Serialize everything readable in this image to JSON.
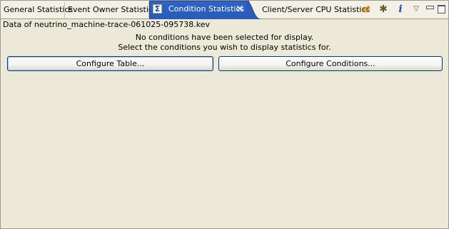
{
  "tabs": [
    {
      "label": "General Statistics",
      "active": false
    },
    {
      "label": "Event Owner Statistics",
      "active": false
    },
    {
      "label": "Condition Statistics",
      "active": true,
      "icon": "sigma-icon"
    },
    {
      "label": "Client/Server CPU Statistics",
      "active": false
    }
  ],
  "active_tab_close": "✕",
  "toolbar": {
    "sync_icon": "⇄",
    "bug_icon": "✱",
    "info_icon": "i",
    "menu_icon": "▽"
  },
  "content": {
    "file_label": "Data of neutrino_machine-trace-061025-095738.kev",
    "message_line1": "No conditions have been selected for display.",
    "message_line2": "Select the conditions you wish to display statistics for.",
    "configure_table_label": "Configure Table...",
    "configure_conditions_label": "Configure Conditions..."
  },
  "colors": {
    "active_tab": "#2c64c8",
    "background": "#ece9d8",
    "button_border": "#003c74"
  }
}
